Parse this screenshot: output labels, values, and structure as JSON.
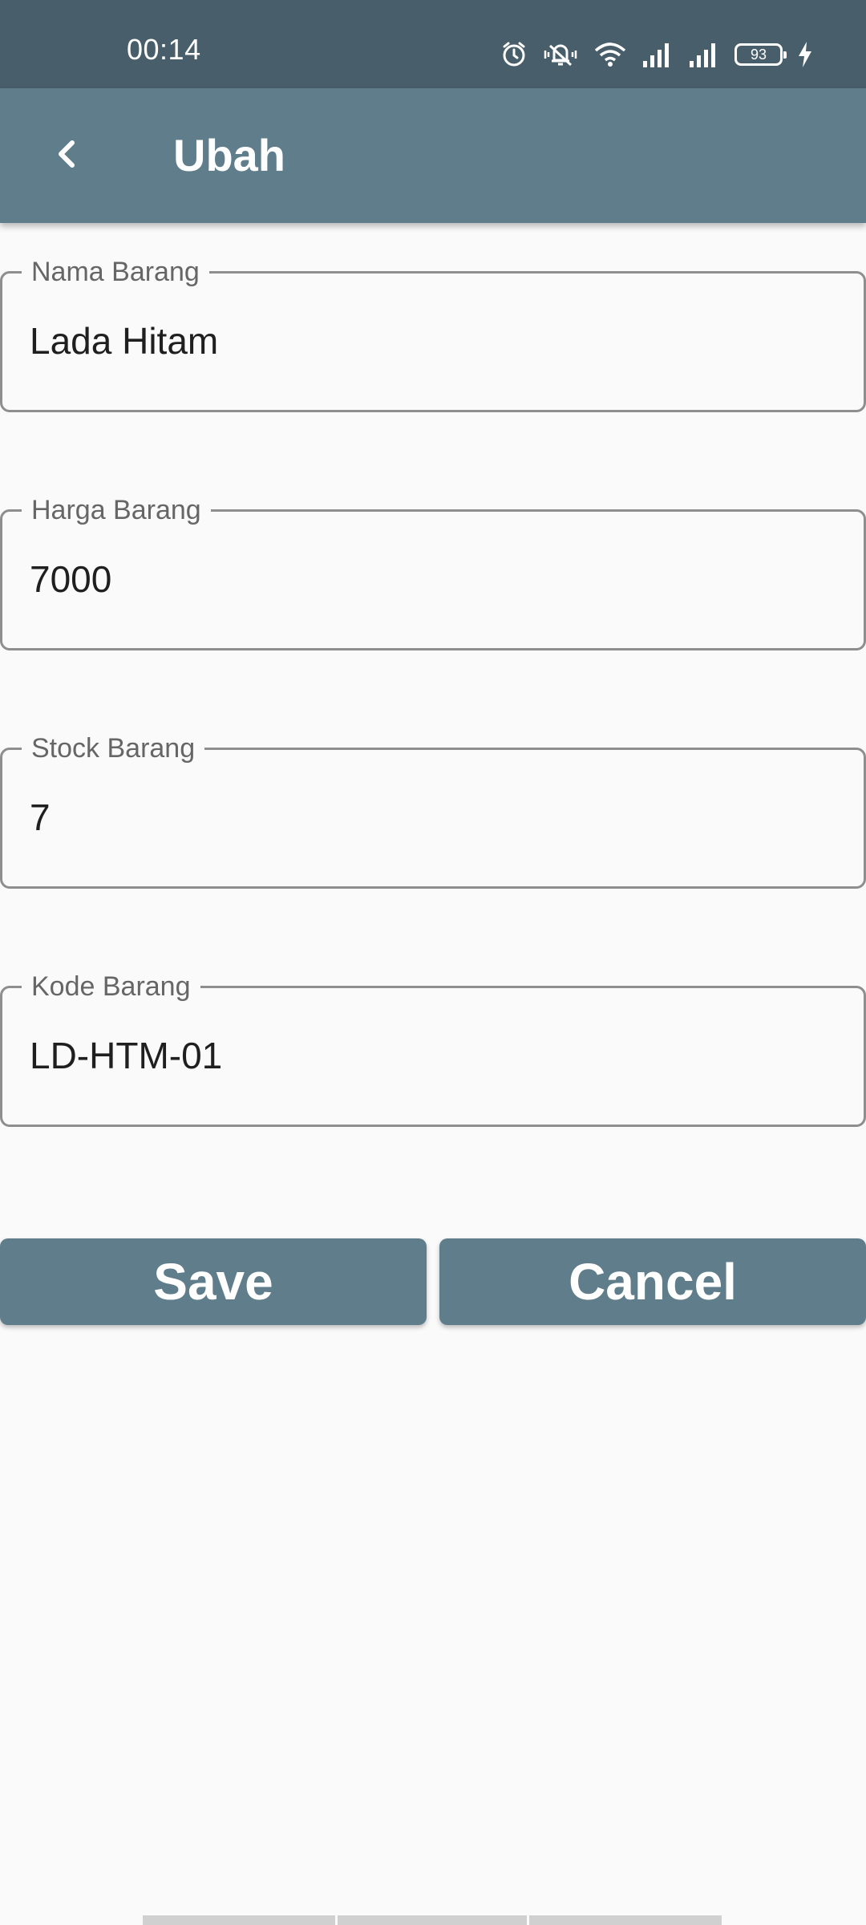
{
  "status_bar": {
    "time": "00:14",
    "battery_level": "93",
    "icons": [
      "alarm-icon",
      "mute-icon",
      "wifi-icon",
      "signal-icon",
      "signal-icon",
      "battery-icon",
      "charging-icon"
    ]
  },
  "app_bar": {
    "title": "Ubah",
    "back_icon": "chevron-left-icon"
  },
  "form": {
    "fields": [
      {
        "label": "Nama Barang",
        "value": "Lada Hitam"
      },
      {
        "label": "Harga Barang",
        "value": "7000"
      },
      {
        "label": "Stock Barang",
        "value": "7"
      },
      {
        "label": "Kode Barang",
        "value": "LD-HTM-01"
      }
    ]
  },
  "actions": {
    "save_label": "Save",
    "cancel_label": "Cancel"
  },
  "colors": {
    "status_bar": "#485f6b",
    "app_bar": "#607d8b",
    "button": "#607d8b",
    "background": "#fafafa"
  }
}
